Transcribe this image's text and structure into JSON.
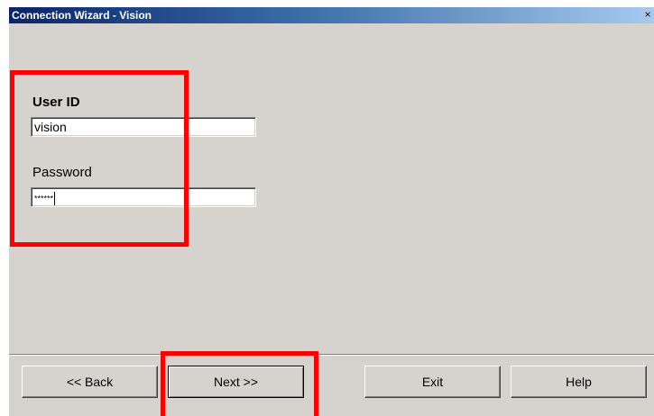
{
  "window": {
    "title": "Connection Wizard - Vision",
    "close_glyph": "×"
  },
  "form": {
    "user_id_label": "User ID",
    "user_id_value": "vision",
    "password_label": "Password",
    "password_mask": "******"
  },
  "buttons": {
    "back": "<< Back",
    "next": "Next >>",
    "exit": "Exit",
    "help": "Help"
  },
  "colors": {
    "highlight": "#ff0000",
    "dialog_bg": "#d6d3ce",
    "titlebar_start": "#0a246a"
  }
}
